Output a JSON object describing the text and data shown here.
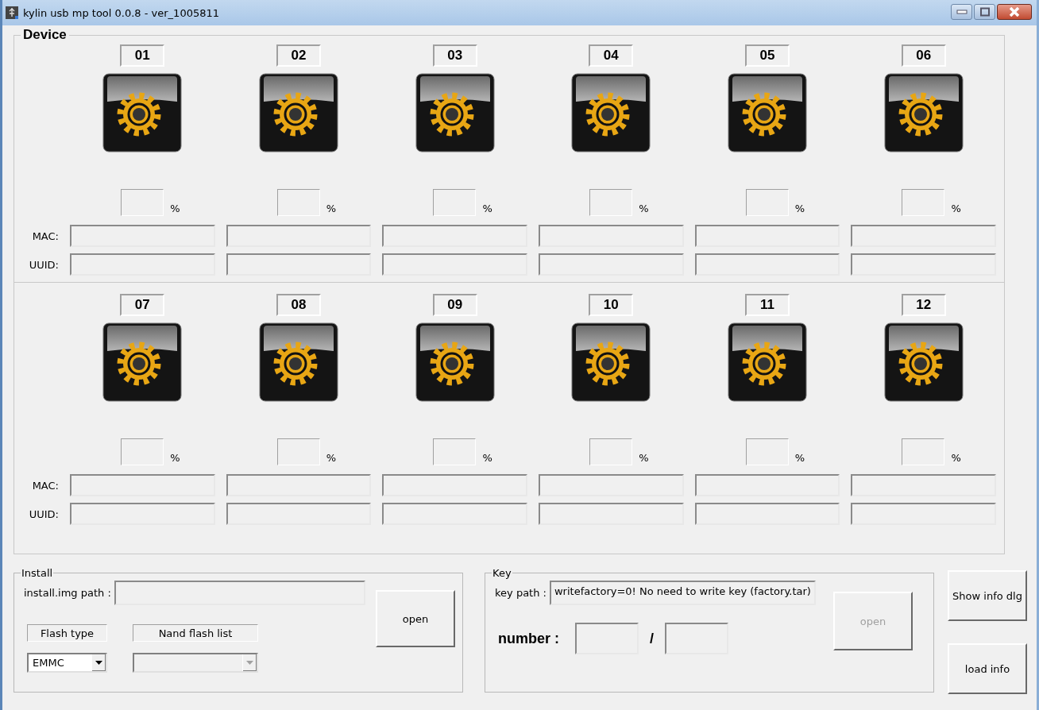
{
  "window": {
    "title": "kylin usb mp tool 0.0.8 - ver_1005811"
  },
  "device": {
    "title": "Device",
    "banks": [
      {
        "mac_label": "MAC:",
        "uuid_label": "UUID:",
        "slots": [
          {
            "number": "01",
            "unit": "%"
          },
          {
            "number": "02",
            "unit": "%"
          },
          {
            "number": "03",
            "unit": "%"
          },
          {
            "number": "04",
            "unit": "%"
          },
          {
            "number": "05",
            "unit": "%"
          },
          {
            "number": "06",
            "unit": "%"
          }
        ]
      },
      {
        "mac_label": "MAC:",
        "uuid_label": "UUID:",
        "slots": [
          {
            "number": "07",
            "unit": "%"
          },
          {
            "number": "08",
            "unit": "%"
          },
          {
            "number": "09",
            "unit": "%"
          },
          {
            "number": "10",
            "unit": "%"
          },
          {
            "number": "11",
            "unit": "%"
          },
          {
            "number": "12",
            "unit": "%"
          }
        ]
      }
    ]
  },
  "install": {
    "title": "Install",
    "path_label": "install.img path :",
    "open_button": {
      "label": "open",
      "disabled": false
    },
    "flash_type_label": "Flash type",
    "flash_type": {
      "value": "EMMC",
      "disabled": false
    },
    "nand_label": "Nand flash list",
    "nand_list": {
      "disabled": true
    }
  },
  "key": {
    "title": "Key",
    "path_label": "key path :",
    "path_value": "writefactory=0! No need to write key (factory.tar)",
    "open_button": {
      "label": "open",
      "disabled": true
    },
    "number_label": "number :",
    "separator": "/"
  },
  "side_buttons": [
    {
      "label": "Show info dlg"
    },
    {
      "label": "load info"
    }
  ]
}
